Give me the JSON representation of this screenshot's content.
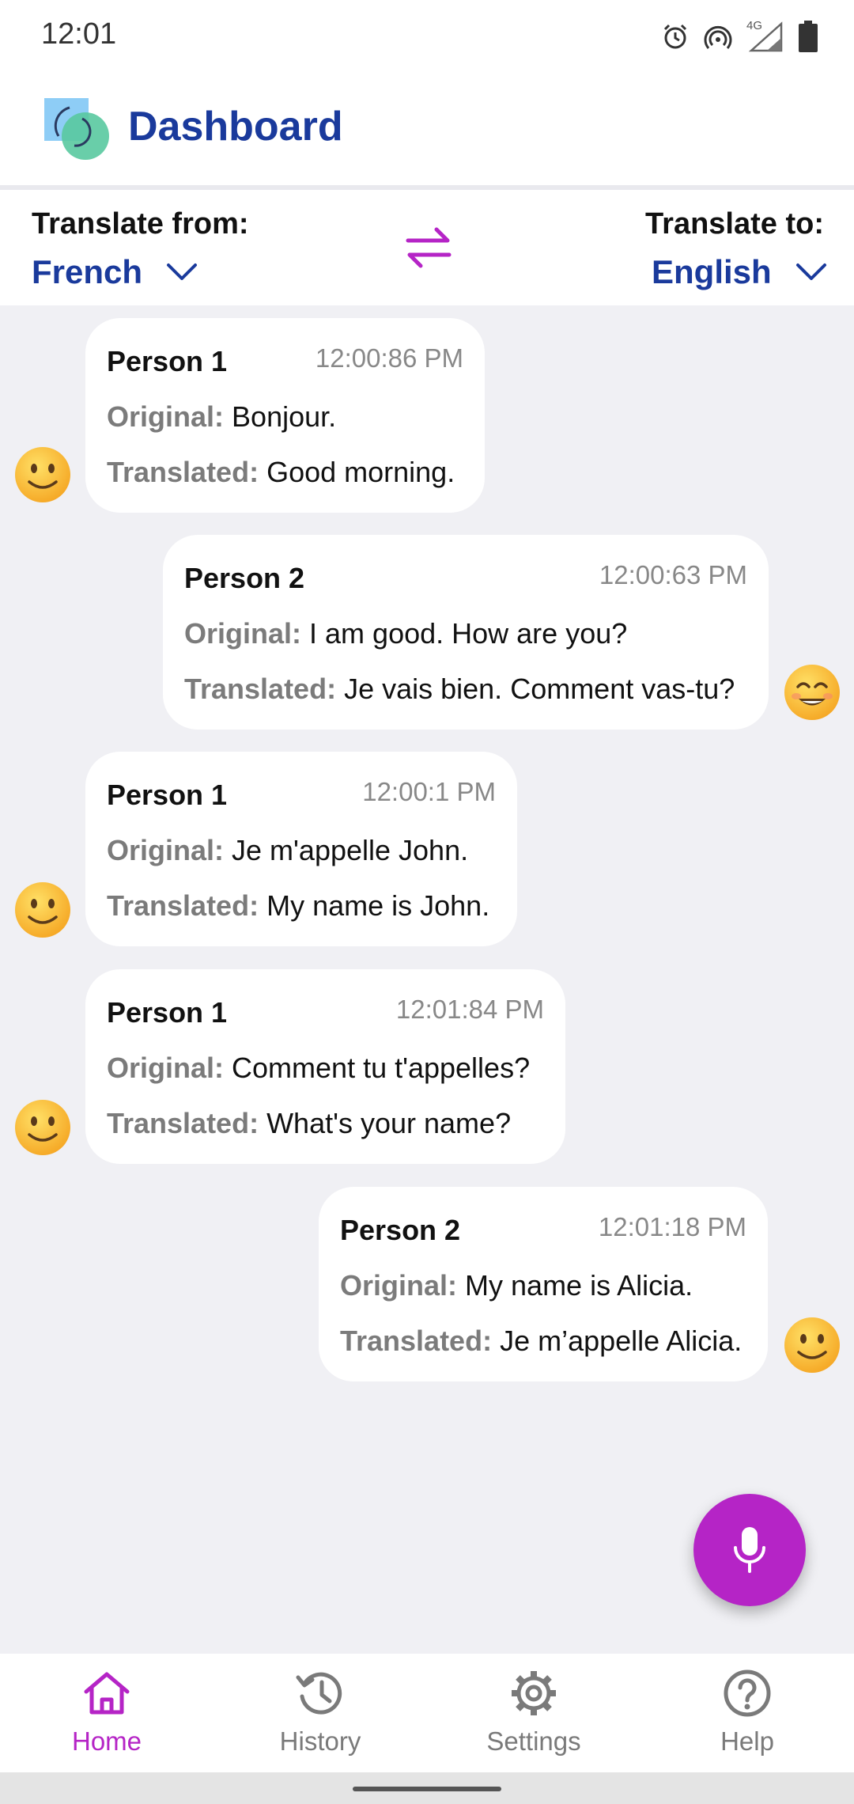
{
  "status_bar": {
    "time": "12:01",
    "icons": [
      "alarm-icon",
      "hotspot-icon",
      "4g-icon",
      "signal-icon",
      "battery-icon"
    ],
    "network_label": "4G"
  },
  "header": {
    "title": "Dashboard",
    "logo_icon": "app-logo-icon"
  },
  "language_bar": {
    "from_label": "Translate from:",
    "from_value": "French",
    "to_label": "Translate to:",
    "to_value": "English",
    "swap_icon": "swap-arrows-icon"
  },
  "messages": [
    {
      "speaker": "Person 1",
      "time": "12:00:86 PM",
      "original_label": "Original:",
      "original": "Bonjour.",
      "translated_label": "Translated:",
      "translated": "Good morning.",
      "avatar": "slightly-smiling-face-icon"
    },
    {
      "speaker": "Person 2",
      "time": "12:00:63 PM",
      "original_label": "Original:",
      "original": "I am good. How are you?",
      "translated_label": "Translated:",
      "translated": "Je vais bien. Comment vas-tu?",
      "avatar": "smiling-face-with-smiling-eyes-icon"
    },
    {
      "speaker": "Person 1",
      "time": "12:00:1 PM",
      "original_label": "Original:",
      "original": "Je m'appelle John.",
      "translated_label": "Translated:",
      "translated": "My name is John.",
      "avatar": "slightly-smiling-face-icon"
    },
    {
      "speaker": "Person 1",
      "time": "12:01:84 PM",
      "original_label": "Original:",
      "original": "Comment tu t'appelles?",
      "translated_label": "Translated:",
      "translated": "What's your name?",
      "avatar": "slightly-smiling-face-icon"
    },
    {
      "speaker": "Person 2",
      "time": "12:01:18 PM",
      "original_label": "Original:",
      "original": "My name is Alicia.",
      "translated_label": "Translated:",
      "translated": "Je m’appelle Alicia.",
      "avatar": "slightly-smiling-face-icon"
    }
  ],
  "mic_button": {
    "icon": "microphone-icon"
  },
  "bottom_nav": [
    {
      "label": "Home",
      "icon": "home-icon",
      "active": true
    },
    {
      "label": "History",
      "icon": "history-icon",
      "active": false
    },
    {
      "label": "Settings",
      "icon": "gear-icon",
      "active": false
    },
    {
      "label": "Help",
      "icon": "help-icon",
      "active": false
    }
  ],
  "colors": {
    "brand_blue": "#1a3a9c",
    "accent_purple": "#b524c6",
    "background": "#f0f0f4",
    "label_gray": "#7b7b7b"
  }
}
